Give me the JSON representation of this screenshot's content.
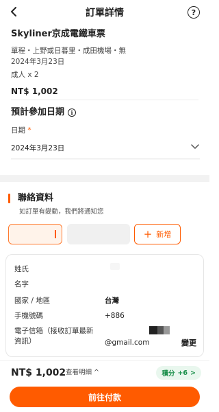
{
  "header": {
    "title": "訂單詳情",
    "back_icon": "chevron-left-icon",
    "help_icon": "question-circle-icon",
    "help_glyph": "?"
  },
  "ticket": {
    "name": "Skyliner京成電鐵車票",
    "route": "單程・上野或日暮里・成田機場・無",
    "date": "2024年3月23日",
    "quantity": "成人 x 2",
    "price": "NT$ 1,002"
  },
  "participation_date": {
    "title": "預計參加日期",
    "info_icon": "info-circle-icon",
    "info_glyph": "i",
    "label": "日期",
    "required_mark": "*",
    "value": "2024年3月23日",
    "chevron_icon": "chevron-down-icon"
  },
  "contact": {
    "title": "聯絡資料",
    "subtitle": "如訂單有變動，我們將通知您",
    "add_button": "新增",
    "add_glyph": "+",
    "fields": {
      "last_name_label": "姓氏",
      "first_name_label": "名字",
      "country_label": "國家 / 地區",
      "country_value": "台灣",
      "phone_label": "手機號碼",
      "phone_value": "+886",
      "email_label": "電子信箱（接收訂單最新資訊）",
      "email_value": "@gmail.com"
    },
    "edit_link": "變更"
  },
  "footer": {
    "total": "NT$ 1,002",
    "details_link": "查看明細",
    "details_glyph": "^",
    "points_label": "積分",
    "points_value": "+6",
    "points_glyph": ">",
    "pay_button": "前往付款"
  },
  "colors": {
    "accent": "#ff5b00",
    "points_bg": "#e9f7ee",
    "points_text": "#1a8f4a"
  }
}
